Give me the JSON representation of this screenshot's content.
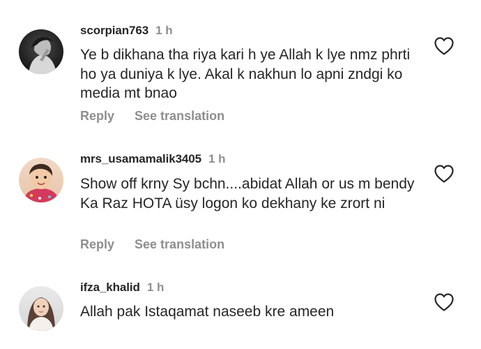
{
  "comments": [
    {
      "username": "scorpian763",
      "time": "1 h",
      "text": "Ye b dikhana tha riya kari h ye Allah k lye nmz phrti ho ya duniya k lye.  Akal k nakhun lo  apni zndgi ko  media mt bnao",
      "reply_label": "Reply",
      "translation_label": "See translation",
      "like_icon": "heart-outline-icon"
    },
    {
      "username": "mrs_usamamalik3405",
      "time": "1 h",
      "text": "Show off krny Sy bchn....abidat Allah or us m bendy Ka Raz HOTA üsy logon ko dekhany ke zrort ni",
      "reply_label": "Reply",
      "translation_label": "See translation",
      "like_icon": "heart-outline-icon"
    },
    {
      "username": "ifza_khalid",
      "time": "1 h",
      "text": "Allah pak Istaqamat naseeb kre ameen",
      "like_icon": "heart-outline-icon"
    }
  ],
  "colors": {
    "primary_text": "#262626",
    "secondary_text": "#8e8e8e",
    "background": "#ffffff"
  }
}
